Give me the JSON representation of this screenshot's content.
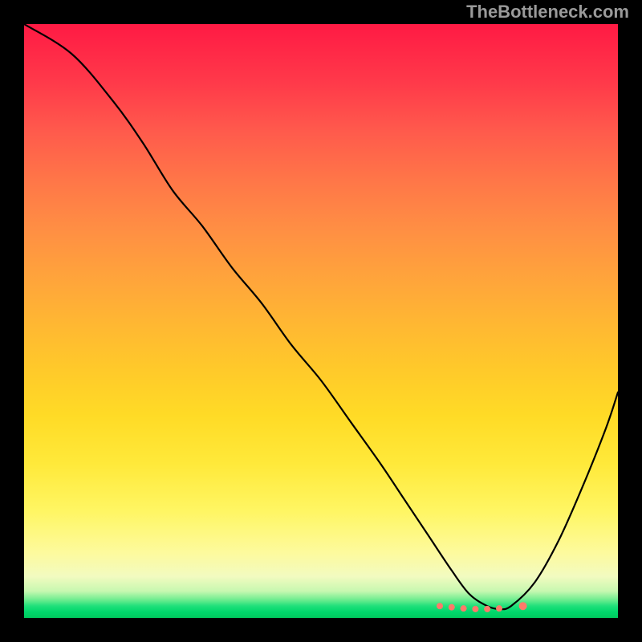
{
  "watermark": "TheBottleneck.com",
  "chart_data": {
    "type": "line",
    "title": "",
    "xlabel": "",
    "ylabel": "",
    "xlim": [
      0,
      100
    ],
    "ylim": [
      0,
      100
    ],
    "background_gradient": {
      "direction": "vertical",
      "stops": [
        {
          "pos": 0,
          "color": "#ff1a44",
          "meaning": "high"
        },
        {
          "pos": 50,
          "color": "#ffc92a",
          "meaning": "mid"
        },
        {
          "pos": 100,
          "color": "#00c95e",
          "meaning": "low"
        }
      ]
    },
    "series": [
      {
        "name": "bottleneck-curve",
        "color": "#000000",
        "x": [
          0,
          8,
          15,
          20,
          25,
          30,
          35,
          40,
          45,
          50,
          55,
          60,
          64,
          68,
          72,
          75,
          78,
          80,
          82,
          86,
          90,
          94,
          98,
          100
        ],
        "y": [
          100,
          95,
          87,
          80,
          72,
          66,
          59,
          53,
          46,
          40,
          33,
          26,
          20,
          14,
          8,
          4,
          2,
          1.5,
          2,
          6,
          13,
          22,
          32,
          38
        ]
      }
    ],
    "markers": [
      {
        "name": "optimal-cluster-start",
        "x": 70,
        "y": 2.0,
        "color": "#ff7a6a",
        "r": 4
      },
      {
        "name": "optimal-cluster-a",
        "x": 72,
        "y": 1.8,
        "color": "#ff7a6a",
        "r": 4
      },
      {
        "name": "optimal-cluster-b",
        "x": 74,
        "y": 1.6,
        "color": "#ff7a6a",
        "r": 4
      },
      {
        "name": "optimal-cluster-c",
        "x": 76,
        "y": 1.5,
        "color": "#ff7a6a",
        "r": 4
      },
      {
        "name": "optimal-cluster-d",
        "x": 78,
        "y": 1.5,
        "color": "#ff7a6a",
        "r": 4
      },
      {
        "name": "optimal-cluster-e",
        "x": 80,
        "y": 1.6,
        "color": "#ff7a6a",
        "r": 4
      },
      {
        "name": "optimal-cluster-end",
        "x": 84,
        "y": 2.0,
        "color": "#ff7a6a",
        "r": 5
      }
    ]
  }
}
